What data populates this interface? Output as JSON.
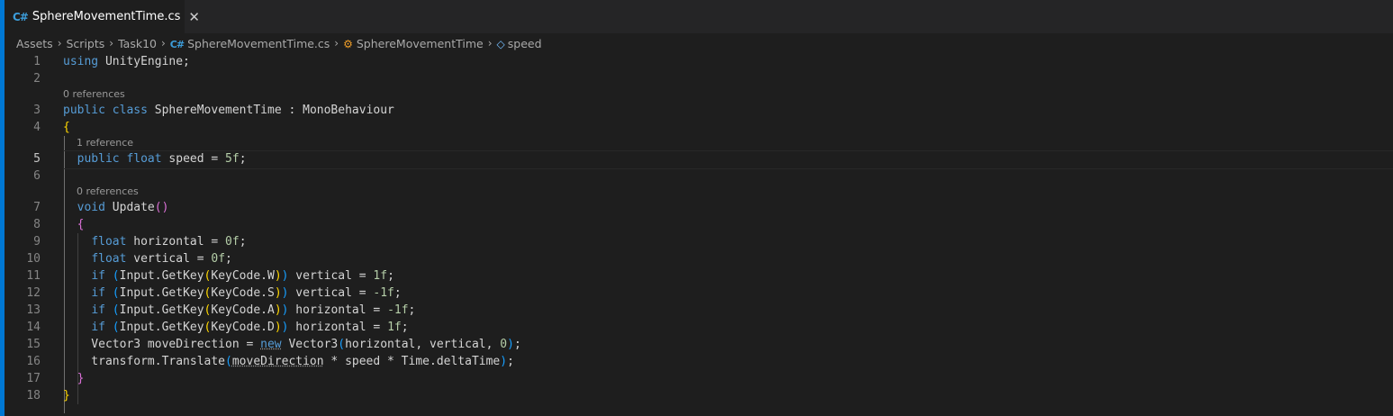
{
  "tab": {
    "icon": "csharp-file-icon",
    "icon_text": "C#",
    "title": "SphereMovementTime.cs",
    "close_glyph": "✕"
  },
  "breadcrumb": {
    "items": [
      "Assets",
      "Scripts",
      "Task10",
      "SphereMovementTime.cs",
      "SphereMovementTime",
      "speed"
    ],
    "file_icon_text": "C#",
    "class_icon_glyph": "⚙",
    "field_icon_glyph": "◇"
  },
  "editor": {
    "active_line": 5,
    "line_numbers": [
      "1",
      "2",
      "3",
      "4",
      "5",
      "6",
      "7",
      "8",
      "9",
      "10",
      "11",
      "12",
      "13",
      "14",
      "15",
      "16",
      "17",
      "18"
    ],
    "codelens": [
      "0 references",
      "1 reference",
      "0 references"
    ],
    "lines": [
      [
        {
          "t": "using",
          "c": "kw"
        },
        {
          "t": " UnityEngine;",
          "c": "id"
        }
      ],
      [],
      [
        {
          "t": "public",
          "c": "kw"
        },
        {
          "t": " ",
          "c": "id"
        },
        {
          "t": "class",
          "c": "kw"
        },
        {
          "t": " SphereMovementTime : MonoBehaviour",
          "c": "id"
        }
      ],
      [
        {
          "t": "{",
          "c": "b1"
        }
      ],
      [
        {
          "t": "  ",
          "c": "id"
        },
        {
          "t": "public",
          "c": "kw"
        },
        {
          "t": " ",
          "c": "id"
        },
        {
          "t": "float",
          "c": "kw"
        },
        {
          "t": " speed = ",
          "c": "id"
        },
        {
          "t": "5f",
          "c": "num"
        },
        {
          "t": ";",
          "c": "id"
        }
      ],
      [],
      [
        {
          "t": "  ",
          "c": "id"
        },
        {
          "t": "void",
          "c": "kw"
        },
        {
          "t": " ",
          "c": "id"
        },
        {
          "t": "Update",
          "c": "id"
        },
        {
          "t": "()",
          "c": "b2"
        }
      ],
      [
        {
          "t": "  ",
          "c": "id"
        },
        {
          "t": "{",
          "c": "b2"
        }
      ],
      [
        {
          "t": "    ",
          "c": "id"
        },
        {
          "t": "float",
          "c": "kw"
        },
        {
          "t": " horizontal = ",
          "c": "id"
        },
        {
          "t": "0f",
          "c": "num"
        },
        {
          "t": ";",
          "c": "id"
        }
      ],
      [
        {
          "t": "    ",
          "c": "id"
        },
        {
          "t": "float",
          "c": "kw"
        },
        {
          "t": " vertical = ",
          "c": "id"
        },
        {
          "t": "0f",
          "c": "num"
        },
        {
          "t": ";",
          "c": "id"
        }
      ],
      [
        {
          "t": "    ",
          "c": "id"
        },
        {
          "t": "if",
          "c": "kw"
        },
        {
          "t": " ",
          "c": "id"
        },
        {
          "t": "(",
          "c": "b3"
        },
        {
          "t": "Input.GetKey",
          "c": "id"
        },
        {
          "t": "(",
          "c": "b1"
        },
        {
          "t": "KeyCode.W",
          "c": "id"
        },
        {
          "t": ")",
          "c": "b1"
        },
        {
          "t": ")",
          "c": "b3"
        },
        {
          "t": " vertical = ",
          "c": "id"
        },
        {
          "t": "1f",
          "c": "num"
        },
        {
          "t": ";",
          "c": "id"
        }
      ],
      [
        {
          "t": "    ",
          "c": "id"
        },
        {
          "t": "if",
          "c": "kw"
        },
        {
          "t": " ",
          "c": "id"
        },
        {
          "t": "(",
          "c": "b3"
        },
        {
          "t": "Input.GetKey",
          "c": "id"
        },
        {
          "t": "(",
          "c": "b1"
        },
        {
          "t": "KeyCode.S",
          "c": "id"
        },
        {
          "t": ")",
          "c": "b1"
        },
        {
          "t": ")",
          "c": "b3"
        },
        {
          "t": " vertical = ",
          "c": "id"
        },
        {
          "t": "-1f",
          "c": "num"
        },
        {
          "t": ";",
          "c": "id"
        }
      ],
      [
        {
          "t": "    ",
          "c": "id"
        },
        {
          "t": "if",
          "c": "kw"
        },
        {
          "t": " ",
          "c": "id"
        },
        {
          "t": "(",
          "c": "b3"
        },
        {
          "t": "Input.GetKey",
          "c": "id"
        },
        {
          "t": "(",
          "c": "b1"
        },
        {
          "t": "KeyCode.A",
          "c": "id"
        },
        {
          "t": ")",
          "c": "b1"
        },
        {
          "t": ")",
          "c": "b3"
        },
        {
          "t": " horizontal = ",
          "c": "id"
        },
        {
          "t": "-1f",
          "c": "num"
        },
        {
          "t": ";",
          "c": "id"
        }
      ],
      [
        {
          "t": "    ",
          "c": "id"
        },
        {
          "t": "if",
          "c": "kw"
        },
        {
          "t": " ",
          "c": "id"
        },
        {
          "t": "(",
          "c": "b3"
        },
        {
          "t": "Input.GetKey",
          "c": "id"
        },
        {
          "t": "(",
          "c": "b1"
        },
        {
          "t": "KeyCode.D",
          "c": "id"
        },
        {
          "t": ")",
          "c": "b1"
        },
        {
          "t": ")",
          "c": "b3"
        },
        {
          "t": " horizontal = ",
          "c": "id"
        },
        {
          "t": "1f",
          "c": "num"
        },
        {
          "t": ";",
          "c": "id"
        }
      ],
      [
        {
          "t": "    Vector3 moveDirection = ",
          "c": "id"
        },
        {
          "t": "new",
          "c": "kw dot"
        },
        {
          "t": " Vector3",
          "c": "id"
        },
        {
          "t": "(",
          "c": "b3"
        },
        {
          "t": "horizontal, vertical, ",
          "c": "id"
        },
        {
          "t": "0",
          "c": "num"
        },
        {
          "t": ")",
          "c": "b3"
        },
        {
          "t": ";",
          "c": "id"
        }
      ],
      [
        {
          "t": "    transform.Translate",
          "c": "id"
        },
        {
          "t": "(",
          "c": "b3"
        },
        {
          "t": "moveDirection",
          "c": "id dot"
        },
        {
          "t": " * speed * Time.deltaTime",
          "c": "id"
        },
        {
          "t": ")",
          "c": "b3"
        },
        {
          "t": ";",
          "c": "id"
        }
      ],
      [
        {
          "t": "  ",
          "c": "id"
        },
        {
          "t": "}",
          "c": "b2"
        }
      ],
      [
        {
          "t": "}",
          "c": "b1"
        }
      ]
    ]
  }
}
